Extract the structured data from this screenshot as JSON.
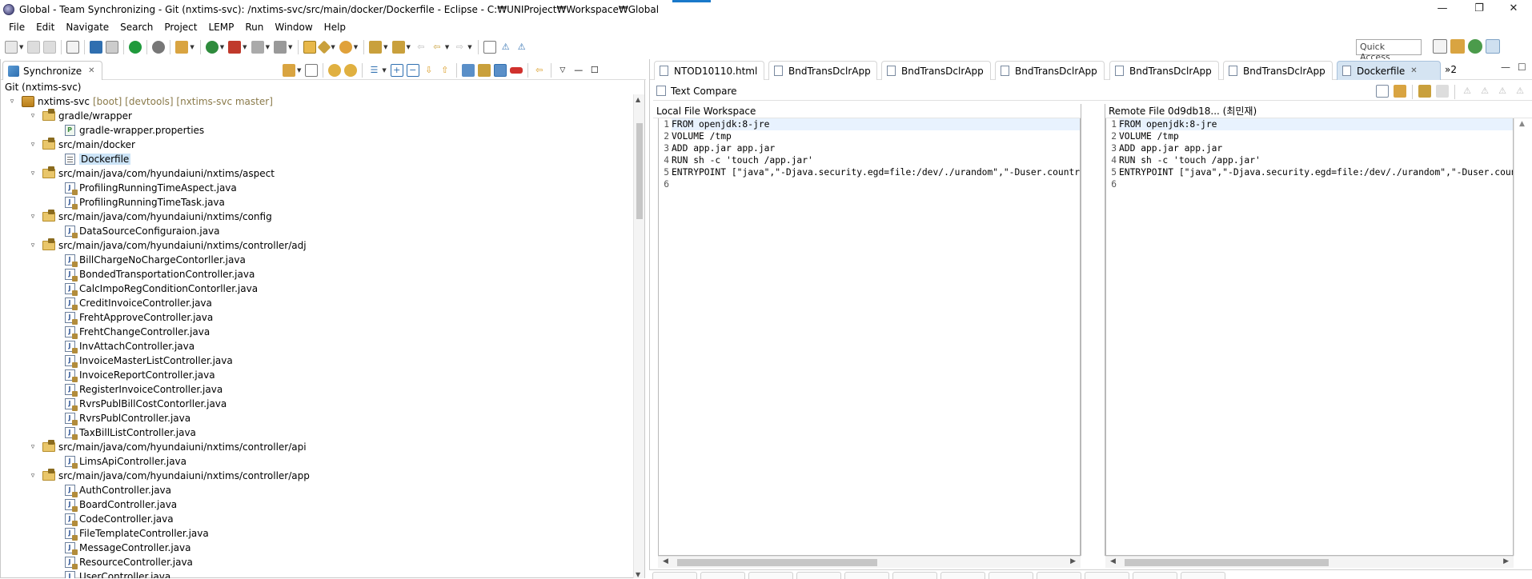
{
  "window": {
    "title": "Global - Team Synchronizing - Git (nxtims-svc): /nxtims-svc/src/main/docker/Dockerfile - Eclipse - C:₩UNIProject₩Workspace₩Global",
    "minimize": "—",
    "restore": "❐",
    "close": "✕"
  },
  "menu": [
    "File",
    "Edit",
    "Navigate",
    "Search",
    "Project",
    "LEMP",
    "Run",
    "Window",
    "Help"
  ],
  "toolbar": {
    "quick_access_placeholder": "Quick Access"
  },
  "left": {
    "tab_label": "Synchronize",
    "tab_close": "✕",
    "subtitle": "Git (nxtims-svc)",
    "tree": [
      {
        "depth": 0,
        "exp": "▿",
        "icon": "project",
        "label": "nxtims-svc",
        "extra": "[boot] [devtools] [nxtims-svc master]"
      },
      {
        "depth": 1,
        "exp": "▿",
        "icon": "folder",
        "label": "gradle/wrapper"
      },
      {
        "depth": 2,
        "exp": "",
        "icon": "props",
        "label": "gradle-wrapper.properties"
      },
      {
        "depth": 1,
        "exp": "▿",
        "icon": "folder",
        "label": "src/main/docker"
      },
      {
        "depth": 2,
        "exp": "",
        "icon": "doc",
        "label": "Dockerfile",
        "selected": true
      },
      {
        "depth": 1,
        "exp": "▿",
        "icon": "folder",
        "label": "src/main/java/com/hyundaiuni/nxtims/aspect"
      },
      {
        "depth": 2,
        "exp": "",
        "icon": "java",
        "label": "ProfilingRunningTimeAspect.java"
      },
      {
        "depth": 2,
        "exp": "",
        "icon": "java",
        "label": "ProfilingRunningTimeTask.java"
      },
      {
        "depth": 1,
        "exp": "▿",
        "icon": "folder",
        "label": "src/main/java/com/hyundaiuni/nxtims/config"
      },
      {
        "depth": 2,
        "exp": "",
        "icon": "java",
        "label": "DataSourceConfiguraion.java"
      },
      {
        "depth": 1,
        "exp": "▿",
        "icon": "folder",
        "label": "src/main/java/com/hyundaiuni/nxtims/controller/adj"
      },
      {
        "depth": 2,
        "exp": "",
        "icon": "java",
        "label": "BillChargeNoChargeContorller.java"
      },
      {
        "depth": 2,
        "exp": "",
        "icon": "java",
        "label": "BondedTransportationController.java"
      },
      {
        "depth": 2,
        "exp": "",
        "icon": "java",
        "label": "CalcImpoRegConditionContorller.java"
      },
      {
        "depth": 2,
        "exp": "",
        "icon": "java",
        "label": "CreditInvoiceController.java"
      },
      {
        "depth": 2,
        "exp": "",
        "icon": "java",
        "label": "FrehtApproveController.java"
      },
      {
        "depth": 2,
        "exp": "",
        "icon": "java",
        "label": "FrehtChangeController.java"
      },
      {
        "depth": 2,
        "exp": "",
        "icon": "java",
        "label": "InvAttachController.java"
      },
      {
        "depth": 2,
        "exp": "",
        "icon": "java",
        "label": "InvoiceMasterListController.java"
      },
      {
        "depth": 2,
        "exp": "",
        "icon": "java",
        "label": "InvoiceReportController.java"
      },
      {
        "depth": 2,
        "exp": "",
        "icon": "java",
        "label": "RegisterInvoiceController.java"
      },
      {
        "depth": 2,
        "exp": "",
        "icon": "java",
        "label": "RvrsPublBillCostContorller.java"
      },
      {
        "depth": 2,
        "exp": "",
        "icon": "java",
        "label": "RvrsPublController.java"
      },
      {
        "depth": 2,
        "exp": "",
        "icon": "java",
        "label": "TaxBillListController.java"
      },
      {
        "depth": 1,
        "exp": "▿",
        "icon": "folder",
        "label": "src/main/java/com/hyundaiuni/nxtims/controller/api"
      },
      {
        "depth": 2,
        "exp": "",
        "icon": "java",
        "label": "LimsApiController.java"
      },
      {
        "depth": 1,
        "exp": "▿",
        "icon": "folder",
        "label": "src/main/java/com/hyundaiuni/nxtims/controller/app"
      },
      {
        "depth": 2,
        "exp": "",
        "icon": "java",
        "label": "AuthController.java"
      },
      {
        "depth": 2,
        "exp": "",
        "icon": "java",
        "label": "BoardController.java"
      },
      {
        "depth": 2,
        "exp": "",
        "icon": "java",
        "label": "CodeController.java"
      },
      {
        "depth": 2,
        "exp": "",
        "icon": "java",
        "label": "FileTemplateController.java"
      },
      {
        "depth": 2,
        "exp": "",
        "icon": "java",
        "label": "MessageController.java"
      },
      {
        "depth": 2,
        "exp": "",
        "icon": "java",
        "label": "ResourceController.java"
      },
      {
        "depth": 2,
        "exp": "",
        "icon": "java",
        "label": "UserController.java"
      }
    ]
  },
  "editor": {
    "tabs": [
      {
        "label": "NTOD10110.html",
        "icon": "html",
        "active": false
      },
      {
        "label": "BndTransDclrApp",
        "icon": "X",
        "active": false
      },
      {
        "label": "BndTransDclrApp",
        "icon": "J",
        "active": false
      },
      {
        "label": "BndTransDclrApp",
        "icon": "J",
        "active": false
      },
      {
        "label": "BndTransDclrApp",
        "icon": "J",
        "active": false
      },
      {
        "label": "BndTransDclrApp",
        "icon": "J",
        "active": false
      },
      {
        "label": "Dockerfile",
        "icon": "doc",
        "active": true
      }
    ],
    "overflow": "»2",
    "compare_title": "Text Compare",
    "local_header": "Local File Workspace",
    "remote_header": "Remote File 0d9db18... (최민재)",
    "local_lines": [
      "FROM openjdk:8-jre",
      "VOLUME /tmp",
      "ADD app.jar app.jar",
      "RUN sh -c 'touch /app.jar'",
      "ENTRYPOINT [\"java\",\"-Djava.security.egd=file:/dev/./urandom\",\"-Duser.country=KR\",\"-Duser.language=ko\",\"-jar\",\"/app.jar\"]",
      ""
    ],
    "remote_lines": [
      "FROM openjdk:8-jre",
      "VOLUME /tmp",
      "ADD app.jar app.jar",
      "RUN sh -c 'touch /app.jar'",
      "ENTRYPOINT [\"java\",\"-Djava.security.egd=file:/dev/./urandom\",\"-Duser.country=KR\",\"-Duser.language=ko\",\"-jar\",\"/app.jar\"]",
      ""
    ]
  },
  "colors": {
    "selection": "#cce4f7",
    "active_tab": "#d5e4f2",
    "folder": "#e9c66a",
    "git_decoration": "#8a7a4a"
  }
}
